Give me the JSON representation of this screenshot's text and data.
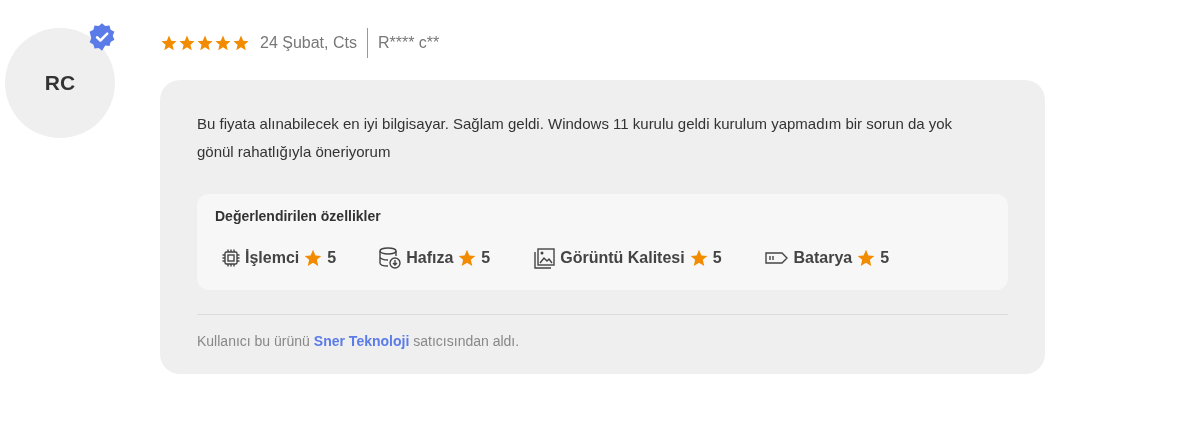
{
  "reviewer": {
    "initials": "RC",
    "verified": true
  },
  "review": {
    "stars": 5,
    "date": "24 Şubat, Cts",
    "author": "R**** c**",
    "text": "Bu fiyata alınabilecek en iyi bilgisayar. Sağlam geldi. Windows 11 kurulu geldi kurulum yapmadım bir sorun da yok gönül rahatlığıyla öneriyorum"
  },
  "rated_features": {
    "title": "Değerlendirilen özellikler",
    "items": [
      {
        "kind": "chip",
        "label": "İşlemci",
        "rating": "5"
      },
      {
        "kind": "storage",
        "label": "Hafıza",
        "rating": "5"
      },
      {
        "kind": "image",
        "label": "Görüntü Kalitesi",
        "rating": "5"
      },
      {
        "kind": "battery",
        "label": "Batarya",
        "rating": "5"
      }
    ]
  },
  "seller_note": {
    "before": "Kullanıcı bu ürünü",
    "seller": "Sner Teknoloji",
    "after": "satıcısından aldı."
  }
}
